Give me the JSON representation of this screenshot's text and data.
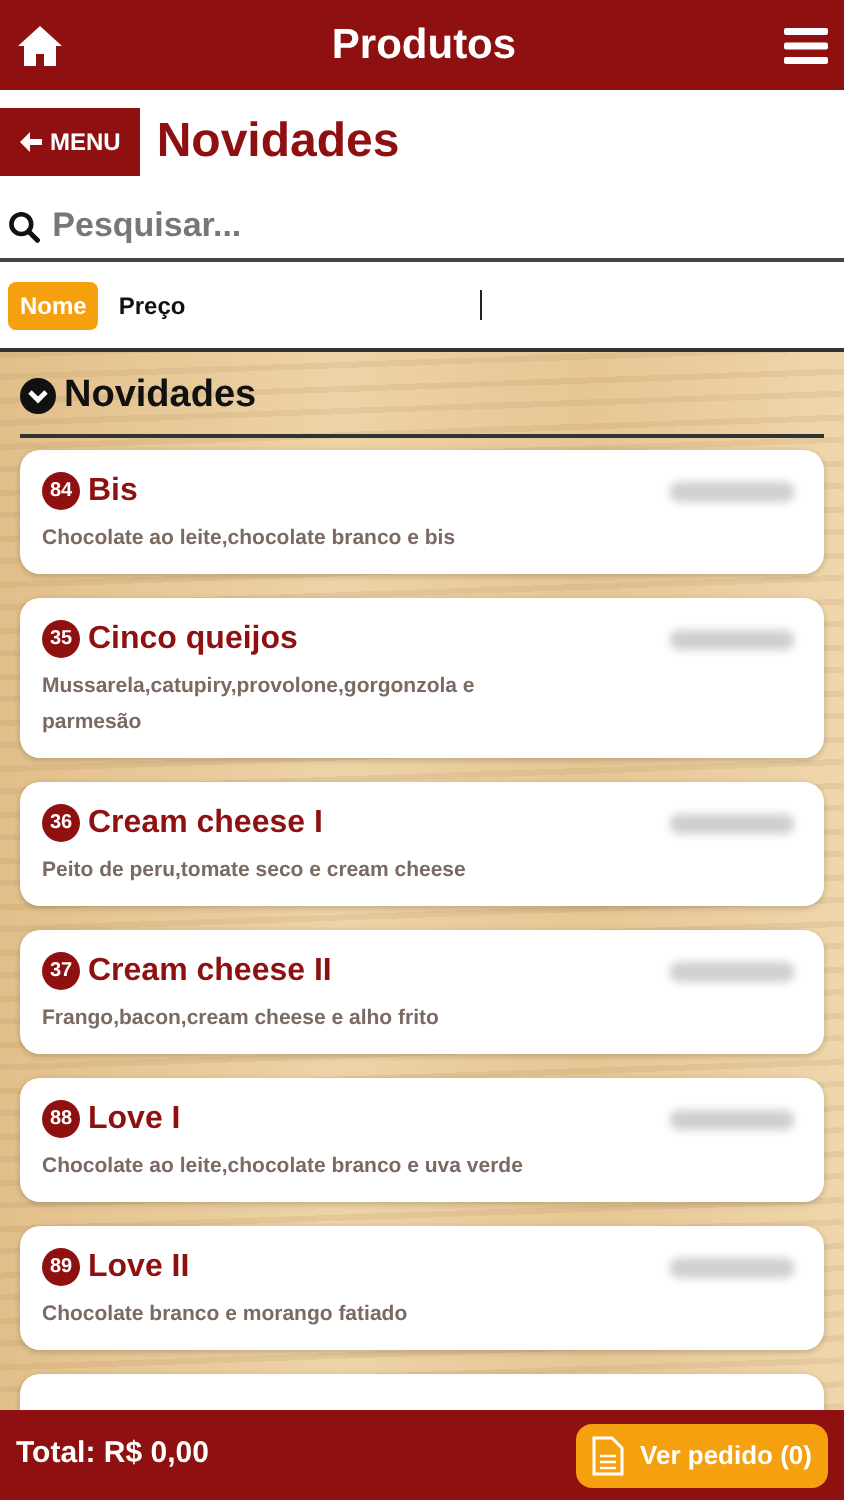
{
  "header": {
    "title": "Produtos"
  },
  "page": {
    "back_button": "MENU",
    "title": "Novidades"
  },
  "search": {
    "placeholder": "Pesquisar..."
  },
  "sort_tabs": [
    {
      "label": "Nome",
      "selected": true
    },
    {
      "label": "Preço",
      "selected": false
    }
  ],
  "section": {
    "title": "Novidades",
    "expanded": true
  },
  "products": [
    {
      "code": "84",
      "name": "Bis",
      "description": "Chocolate ao leite,chocolate branco e bis"
    },
    {
      "code": "35",
      "name": "Cinco queijos",
      "description": "Mussarela,catupiry,provolone,gorgonzola e parmesão"
    },
    {
      "code": "36",
      "name": "Cream cheese I",
      "description": "Peito de peru,tomate seco e cream cheese"
    },
    {
      "code": "37",
      "name": "Cream cheese II",
      "description": "Frango,bacon,cream cheese e alho frito"
    },
    {
      "code": "88",
      "name": "Love I",
      "description": "Chocolate ao leite,chocolate branco e uva verde"
    },
    {
      "code": "89",
      "name": "Love II",
      "description": "Chocolate branco e morango fatiado"
    }
  ],
  "footer": {
    "total": "Total: R$ 0,00",
    "order_button": "Ver pedido (0)"
  }
}
